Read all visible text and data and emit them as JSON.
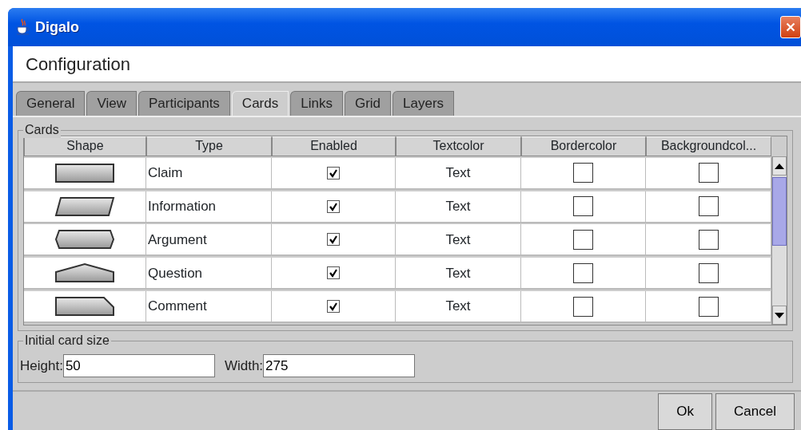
{
  "window": {
    "title": "Digalo"
  },
  "header": {
    "title": "Configuration"
  },
  "tabs": [
    {
      "label": "General",
      "selected": false
    },
    {
      "label": "View",
      "selected": false
    },
    {
      "label": "Participants",
      "selected": false
    },
    {
      "label": "Cards",
      "selected": true
    },
    {
      "label": "Links",
      "selected": false
    },
    {
      "label": "Grid",
      "selected": false
    },
    {
      "label": "Layers",
      "selected": false
    }
  ],
  "cards_group": {
    "title": "Cards",
    "table": {
      "columns": [
        "Shape",
        "Type",
        "Enabled",
        "Textcolor",
        "Bordercolor",
        "Backgroundcol..."
      ],
      "rows": [
        {
          "kind": "rectangle",
          "type": "Claim",
          "enabled": true,
          "textcolor": "Text"
        },
        {
          "kind": "parallelogram",
          "type": "Information",
          "enabled": true,
          "textcolor": "Text"
        },
        {
          "kind": "hexagon",
          "type": "Argument",
          "enabled": true,
          "textcolor": "Text"
        },
        {
          "kind": "pentagon",
          "type": "Question",
          "enabled": true,
          "textcolor": "Text"
        },
        {
          "kind": "cut-corner",
          "type": "Comment",
          "enabled": true,
          "textcolor": "Text"
        }
      ]
    }
  },
  "size_group": {
    "title": "Initial card size",
    "fields": [
      {
        "label": "Height:",
        "value": "50"
      },
      {
        "label": "Width:",
        "value": "275"
      }
    ]
  },
  "buttons": [
    "Ok",
    "Cancel"
  ]
}
